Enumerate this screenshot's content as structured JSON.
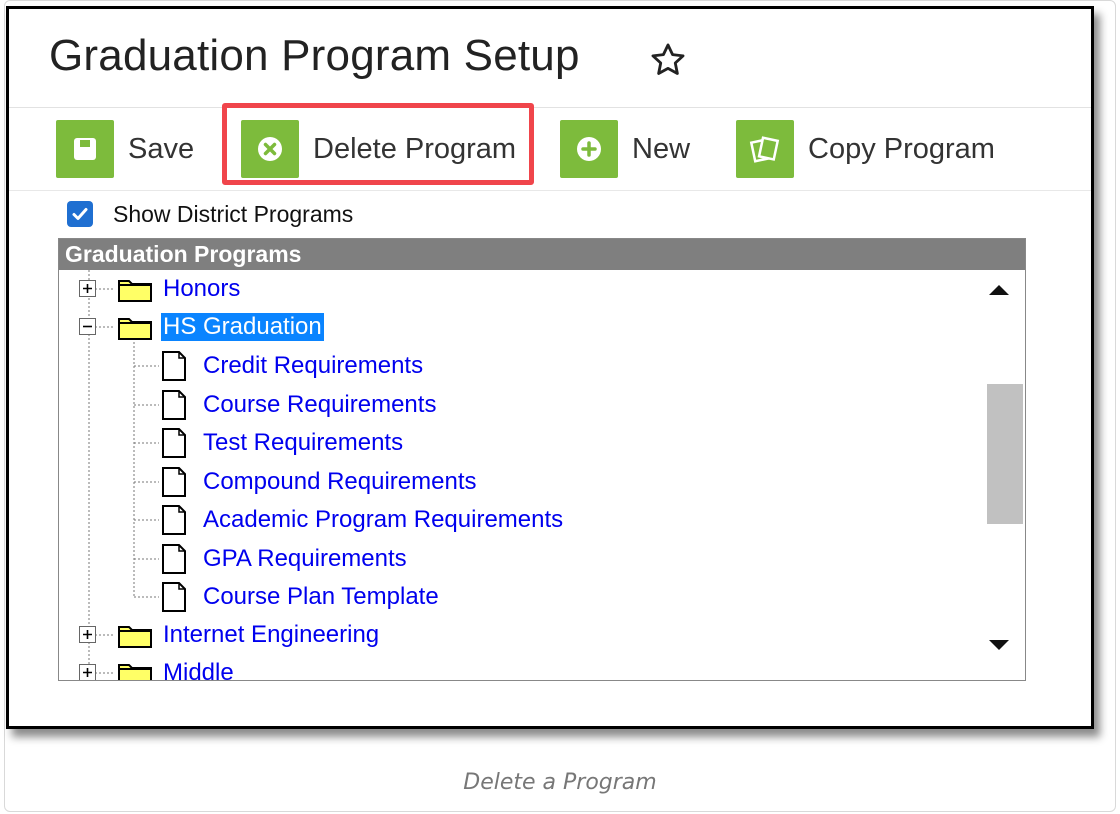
{
  "header": {
    "title": "Graduation Program Setup"
  },
  "toolbar": {
    "save_label": "Save",
    "delete_label": "Delete Program",
    "new_label": "New",
    "copy_label": "Copy Program",
    "accent_color": "#7dbb3c",
    "highlight_color": "#f0454b"
  },
  "filter": {
    "show_district_label": "Show District Programs",
    "show_district_checked": true
  },
  "tree": {
    "header": "Graduation Programs",
    "nodes": [
      {
        "label": "Honors",
        "type": "folder",
        "expanded": false
      },
      {
        "label": "HS Graduation",
        "type": "folder",
        "expanded": true,
        "selected": true
      },
      {
        "label": "Credit Requirements",
        "type": "file"
      },
      {
        "label": "Course Requirements",
        "type": "file"
      },
      {
        "label": "Test Requirements",
        "type": "file"
      },
      {
        "label": "Compound Requirements",
        "type": "file"
      },
      {
        "label": "Academic Program Requirements",
        "type": "file"
      },
      {
        "label": "GPA Requirements",
        "type": "file"
      },
      {
        "label": "Course Plan Template",
        "type": "file"
      },
      {
        "label": "Internet Engineering",
        "type": "folder",
        "expanded": false
      },
      {
        "label": "Middle",
        "type": "folder",
        "expanded": false
      }
    ]
  },
  "caption": "Delete a Program"
}
